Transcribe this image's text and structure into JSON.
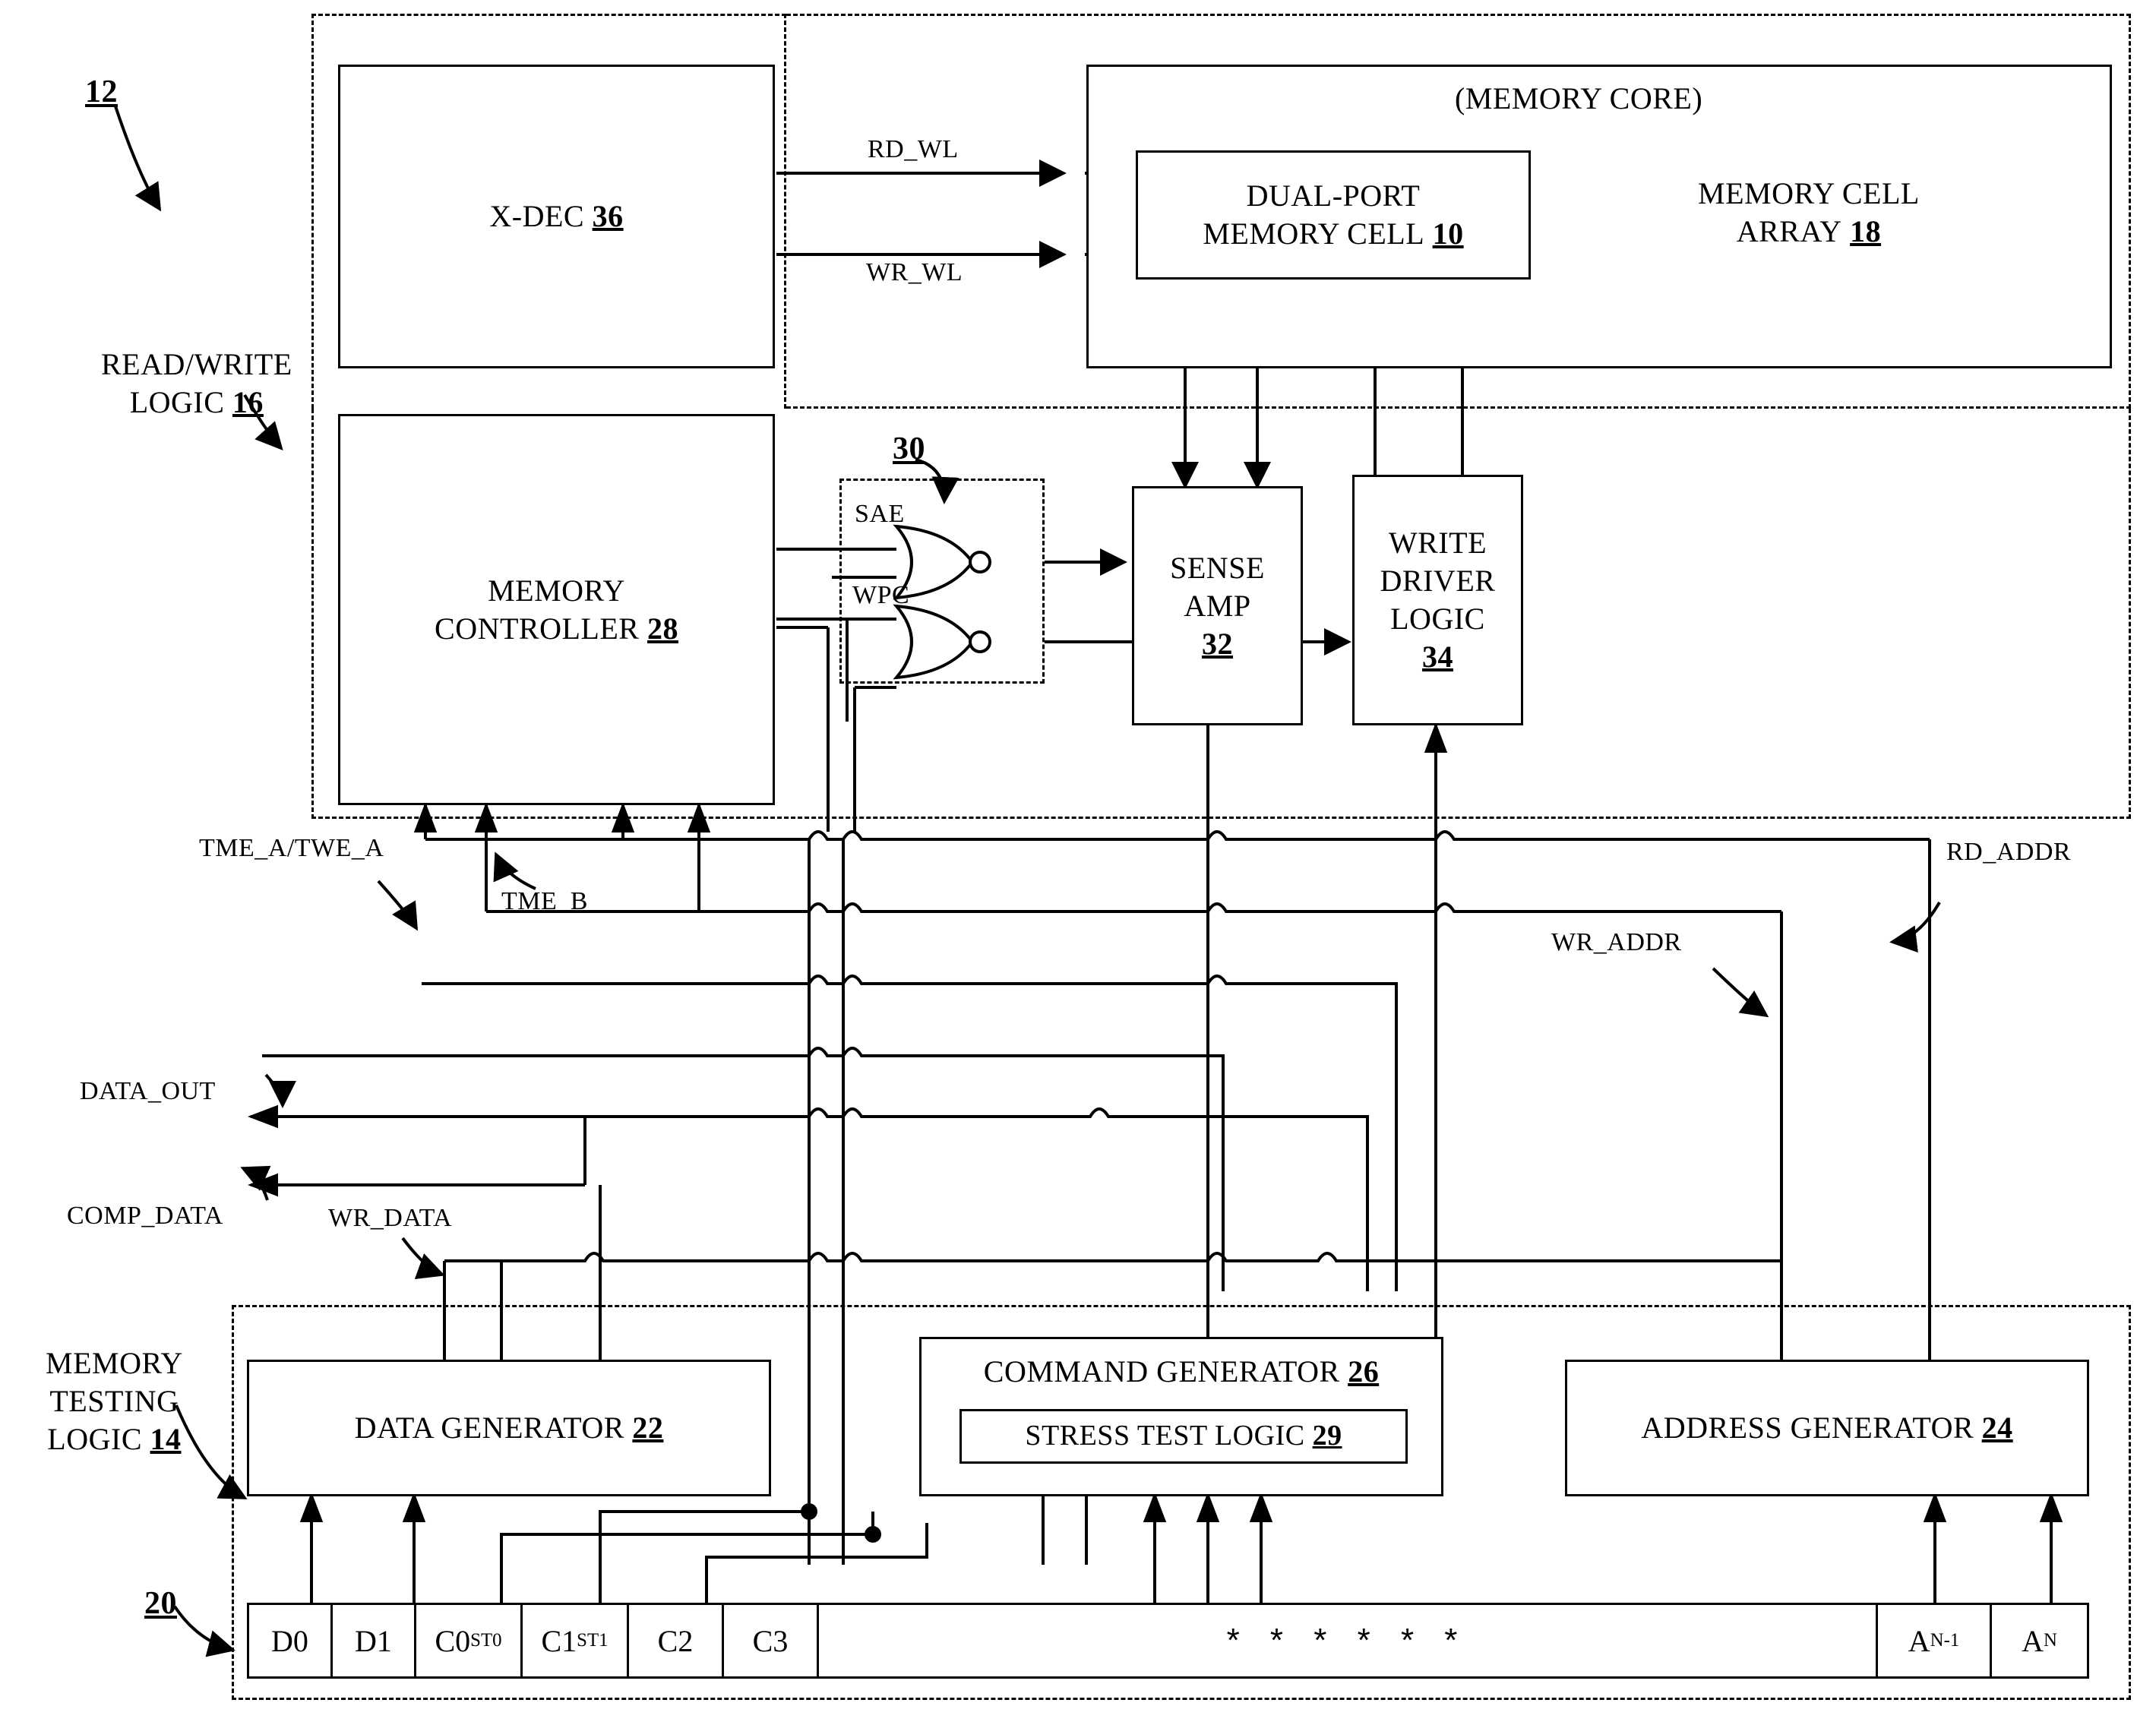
{
  "figure": {
    "ref_top": "12",
    "ref_mux": "30",
    "ref_regfile": "20"
  },
  "groups": {
    "read_write_logic": {
      "line1": "READ/WRITE",
      "line2": "LOGIC",
      "ref": "16"
    },
    "memory_core": {
      "label": "(MEMORY CORE)"
    },
    "memory_testing_logic": {
      "line1": "MEMORY",
      "line2": "TESTING",
      "line3": "LOGIC",
      "ref": "14"
    }
  },
  "blocks": {
    "x_dec": {
      "label": "X-DEC",
      "ref": "36"
    },
    "memory_cell_array": {
      "line1": "MEMORY CELL",
      "line2": "ARRAY",
      "ref": "18"
    },
    "dual_port_cell": {
      "line1": "DUAL-PORT",
      "line2": "MEMORY CELL",
      "ref": "10"
    },
    "memory_controller": {
      "line1": "MEMORY",
      "line2": "CONTROLLER",
      "ref": "28"
    },
    "sense_amp": {
      "line1": "SENSE",
      "line2": "AMP",
      "ref": "32"
    },
    "write_driver": {
      "line1": "WRITE",
      "line2": "DRIVER",
      "line3": "LOGIC",
      "ref": "34"
    },
    "data_generator": {
      "label": "DATA GENERATOR",
      "ref": "22"
    },
    "command_generator": {
      "label": "COMMAND GENERATOR",
      "ref": "26"
    },
    "stress_test_logic": {
      "label": "STRESS TEST LOGIC",
      "ref": "29"
    },
    "address_generator": {
      "label": "ADDRESS GENERATOR",
      "ref": "24"
    }
  },
  "signals": {
    "rd_wl": "RD_WL",
    "wr_wl": "WR_WL",
    "sae": "SAE",
    "wpc": "WPC",
    "tme_a_twe_a": "TME_A/TWE_A",
    "tme_b": "TME_B",
    "rd_addr": "RD_ADDR",
    "wr_addr": "WR_ADDR",
    "data_out": "DATA_OUT",
    "comp_data": "COMP_DATA",
    "wr_data": "WR_DATA"
  },
  "register_row": {
    "cells": [
      {
        "name": "D0",
        "sub": ""
      },
      {
        "name": "D1",
        "sub": ""
      },
      {
        "name": "C0",
        "sub": "ST0"
      },
      {
        "name": "C1",
        "sub": "ST1"
      },
      {
        "name": "C2",
        "sub": ""
      },
      {
        "name": "C3",
        "sub": ""
      },
      {
        "name": "",
        "sub": ""
      },
      {
        "name": "A",
        "sub": "N-1"
      },
      {
        "name": "A",
        "sub": "N"
      }
    ],
    "ellipsis": "* * * * * *"
  },
  "colors": {
    "ink": "#000000",
    "paper": "#ffffff"
  }
}
